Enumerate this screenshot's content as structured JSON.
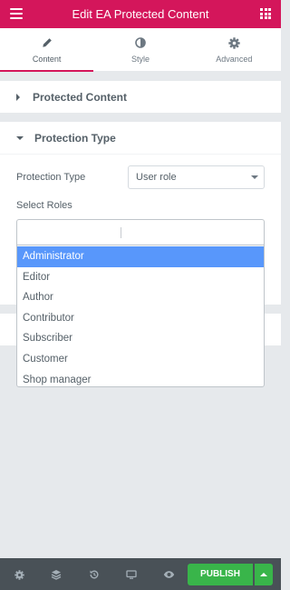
{
  "header": {
    "title": "Edit EA Protected Content"
  },
  "tabs": [
    {
      "label": "Content",
      "active": true
    },
    {
      "label": "Style",
      "active": false
    },
    {
      "label": "Advanced",
      "active": false
    }
  ],
  "sections": {
    "protected_content": {
      "title": "Protected Content"
    },
    "protection_type": {
      "title": "Protection Type"
    }
  },
  "controls": {
    "protection_type_label": "Protection Type",
    "protection_type_value": "User role",
    "select_roles_label": "Select Roles"
  },
  "roles": [
    "Administrator",
    "Editor",
    "Author",
    "Contributor",
    "Subscriber",
    "Customer",
    "Shop manager"
  ],
  "footer": {
    "publish_label": "PUBLISH"
  },
  "colors": {
    "brand": "#d4165b",
    "publish": "#39b54a",
    "highlight": "#5897fb",
    "footer_bg": "#495157"
  }
}
